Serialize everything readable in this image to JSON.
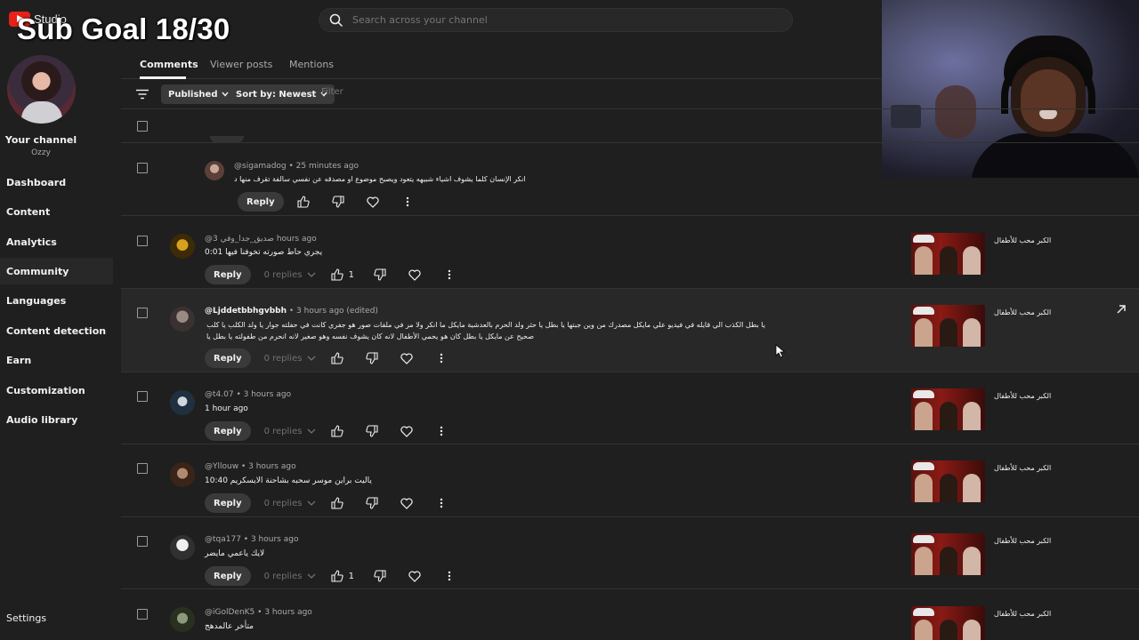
{
  "app": {
    "logo_text": "Studio"
  },
  "overlay": {
    "sub_goal": "Sub Goal 18/30"
  },
  "search": {
    "placeholder": "Search across your channel"
  },
  "sidebar": {
    "channel_title": "Your channel",
    "channel_name": "Ozzy",
    "items": [
      {
        "label": "Dashboard"
      },
      {
        "label": "Content"
      },
      {
        "label": "Analytics"
      },
      {
        "label": "Community",
        "active": true
      },
      {
        "label": "Languages"
      },
      {
        "label": "Content detection"
      },
      {
        "label": "Earn"
      },
      {
        "label": "Customization"
      },
      {
        "label": "Audio library"
      }
    ],
    "settings_label": "Settings"
  },
  "tabs": [
    {
      "label": "Comments",
      "active": true
    },
    {
      "label": "Viewer posts"
    },
    {
      "label": "Mentions"
    }
  ],
  "filters": {
    "published_label": "Published",
    "sort_label": "Sort by: Newest",
    "filter_placeholder": "Filter"
  },
  "comments": [
    {
      "author": "@sigamadog",
      "time": "25 minutes ago",
      "text": "انكر الإنسان كلما يشوف اشياء شبيهه يتعود ويصبح موضوع او مصدقه عن نفسي سالفة تقرف منها د",
      "reply_label": "Reply",
      "replies": "",
      "likes": "",
      "video_title": ""
    },
    {
      "author": "@3",
      "author_suffix": "صديق_جدا_وفي",
      "time": "hours ago",
      "text": "يجري حاط صورته تخوفنا فيها 0:01",
      "reply_label": "Reply",
      "replies": "0 replies",
      "likes": "1",
      "video_title": "الكبر محب للأطفال"
    },
    {
      "author": "@Ljddetbbhgvbbh",
      "time": "3 hours ago (edited)",
      "text": "يا بطل  الكذب الي قايله في فيديو علي مايكل مصدرك من وين جبتها يا بطل يا حثر ولد الحرم بالعدشية مايكل ما انكر ولا مر في ملفات صور هو جفري كانت في حفلته جوار يا ولد الكلب يا كلب يا كذب ما في ابدا شي ذكره",
      "text2": "صحيح عن مايكل يا بطل كان هو يحمي الأطفال لانه كان يشوف نفسه وهو صغير لانه انحرم من طفولته يا بطل يا حثر يا ولد الكلب",
      "reply_label": "Reply",
      "replies": "0 replies",
      "likes": "",
      "video_title": "الكبر محب للأطفال"
    },
    {
      "author": "@t4.07",
      "time": "3 hours ago",
      "text": "1 hour ago",
      "reply_label": "Reply",
      "replies": "0 replies",
      "likes": "",
      "video_title": "الكبر محب للأطفال"
    },
    {
      "author": "@Yllouw",
      "time": "3 hours ago",
      "text": "ياليت براين موسر سحبه بشاحنة الايسكريم 10:40",
      "reply_label": "Reply",
      "replies": "0 replies",
      "likes": "",
      "video_title": "الكبر محب للأطفال"
    },
    {
      "author": "@tqa177",
      "time": "3 hours ago",
      "text": "لايك ياعمي مايضر",
      "reply_label": "Reply",
      "replies": "0 replies",
      "likes": "1",
      "video_title": "الكبر محب للأطفال"
    },
    {
      "author": "@iGolDenK5",
      "time": "3 hours ago",
      "text": "متأخر عالمدهج",
      "reply_label": "Reply",
      "replies": "",
      "likes": "",
      "video_title": "الكبر محب للأطفال"
    }
  ],
  "colors": {
    "background": "#1f1f1f",
    "accent_red": "#e62117",
    "chip": "#3a3a3a",
    "divider": "#333333"
  },
  "icons": [
    "search-icon",
    "filter-icon",
    "chevron-down-icon",
    "thumb-up-icon",
    "thumb-down-icon",
    "heart-icon",
    "more-vert-icon",
    "open-external-icon",
    "checkbox-icon"
  ]
}
